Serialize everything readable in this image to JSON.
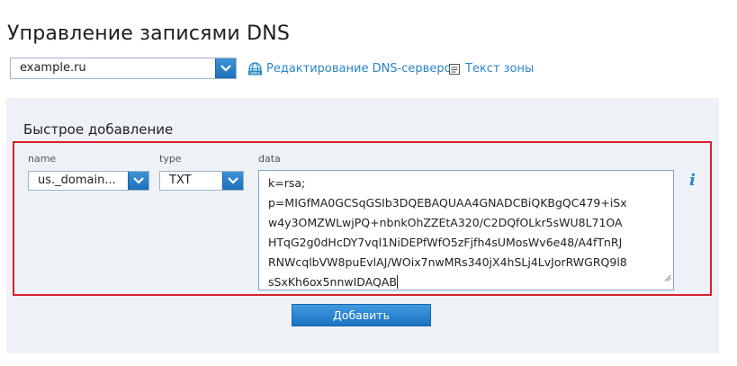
{
  "header": {
    "title": "Управление записями DNS"
  },
  "toolbar": {
    "domain_value": "example.ru",
    "dns_servers_link": "Редактирование DNS-серверов",
    "zone_text_link": "Текст зоны"
  },
  "quick_add": {
    "title": "Быстрое добавление",
    "name_label": "name",
    "name_value": "us._domain...",
    "type_label": "type",
    "type_value": "TXT",
    "data_label": "data",
    "data_lines": [
      "k=rsa;",
      "p=MIGfMA0GCSqGSIb3DQEBAQUAA4GNADCBiQKBgQC479+iSx",
      "w4y3OMZWLwjPQ+nbnkOhZZEtA320/C2DQfOLkr5sWU8L71OA",
      "HTqG2g0dHcDY7vql1NiDEPfWfO5zFjfh4sUMosWv6e48/A4fTnRJ",
      "RNWcqlbVW8puEvlAJ/WOix7nwMRs340jX4hSLj4LvJorRWGRQ9l8",
      "sSxKh6ox5nnwIDAQAB"
    ],
    "info_symbol": "i",
    "add_button_label": "Добавить"
  },
  "colors": {
    "accent": "#2b86c6",
    "highlight_border": "#d6202a",
    "panel_bg": "#eef2f6"
  }
}
